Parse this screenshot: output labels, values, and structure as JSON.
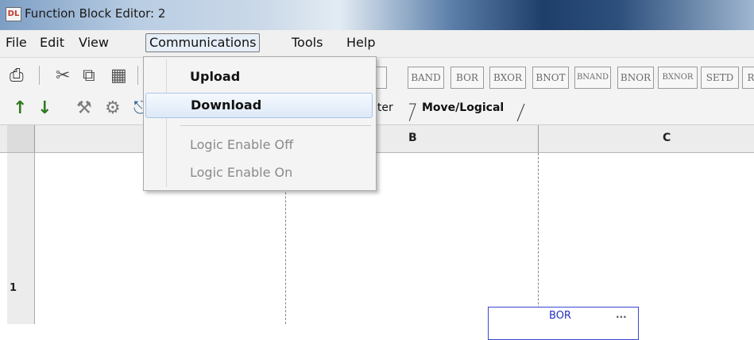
{
  "window": {
    "title": "Function Block Editor: 2",
    "icon_label": "DL",
    "icon_name": "app-icon"
  },
  "menubar": {
    "items": [
      "File",
      "Edit",
      "View",
      "Communications",
      "Tools",
      "Help"
    ],
    "open_menu": "Communications"
  },
  "communications_menu": {
    "items": [
      {
        "label": "Upload",
        "enabled": true
      },
      {
        "label": "Download",
        "enabled": true,
        "highlighted": true
      },
      {
        "label": "Logic Enable Off",
        "enabled": false
      },
      {
        "label": "Logic Enable On",
        "enabled": false
      }
    ]
  },
  "toolbar": {
    "icons": [
      "print-icon",
      "cut-icon",
      "copy-icon",
      "paste-icon",
      "upload-arrow-icon",
      "download-arrow-icon",
      "tool-icon",
      "settings-icon"
    ],
    "logic_buttons": [
      "BAND",
      "BOR",
      "BXOR",
      "BNOT",
      "BNAND",
      "BNOR",
      "BXNOR",
      "SETD",
      "R"
    ]
  },
  "tabs": {
    "partial_label": "nter",
    "active_label": "Move/Logical"
  },
  "grid": {
    "columns": [
      "B",
      "C"
    ],
    "rows": [
      "1"
    ]
  },
  "block": {
    "label": "BOR",
    "menu_glyph": "..."
  },
  "colors": {
    "accent": "#3b46d0",
    "menu_highlight": "#dde9f7"
  }
}
